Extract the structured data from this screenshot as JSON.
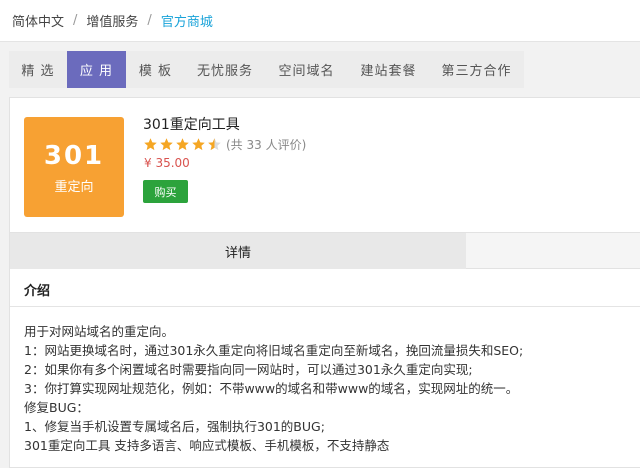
{
  "breadcrumb": [
    "简体中文",
    "增值服务",
    "官方商城"
  ],
  "breadcrumb_separator": "/",
  "tabs": [
    {
      "label": "精 选",
      "active": false
    },
    {
      "label": "应 用",
      "active": true
    },
    {
      "label": "模 板",
      "active": false
    },
    {
      "label": "无忧服务",
      "active": false
    },
    {
      "label": "空间域名",
      "active": false
    },
    {
      "label": "建站套餐",
      "active": false
    },
    {
      "label": "第三方合作",
      "active": false
    }
  ],
  "product": {
    "logo_number": "301",
    "logo_text": "重定向",
    "title": "301重定向工具",
    "rating": 4.5,
    "rating_count_text": "(共 33 人评价)",
    "price": "¥ 35.00",
    "buy_label": "购买"
  },
  "detail_tab": "详情",
  "section": {
    "title": "介绍",
    "lines": [
      " 用于对网站域名的重定向。",
      "1：网站更换域名时，通过301永久重定向将旧域名重定向至新域名，挽回流量损失和SEO;",
      "2：如果你有多个闲置域名时需要指向同一网站时，可以通过301永久重定向实现;",
      "3：你打算实现网址规范化，例如：不带www的域名和带www的域名，实现网址的统一。",
      "修复BUG：",
      "1、修复当手机设置专属域名后，强制执行301的BUG;",
      "301重定向工具 支持多语言、响应式模板、手机模板，不支持静态"
    ]
  },
  "colors": {
    "accent_tab": "#6b6bbd",
    "logo_bg": "#f7a133",
    "star": "#f5a623",
    "price": "#d9534f",
    "buy_button": "#2ca33c",
    "breadcrumb_active": "#1aa3d9"
  }
}
